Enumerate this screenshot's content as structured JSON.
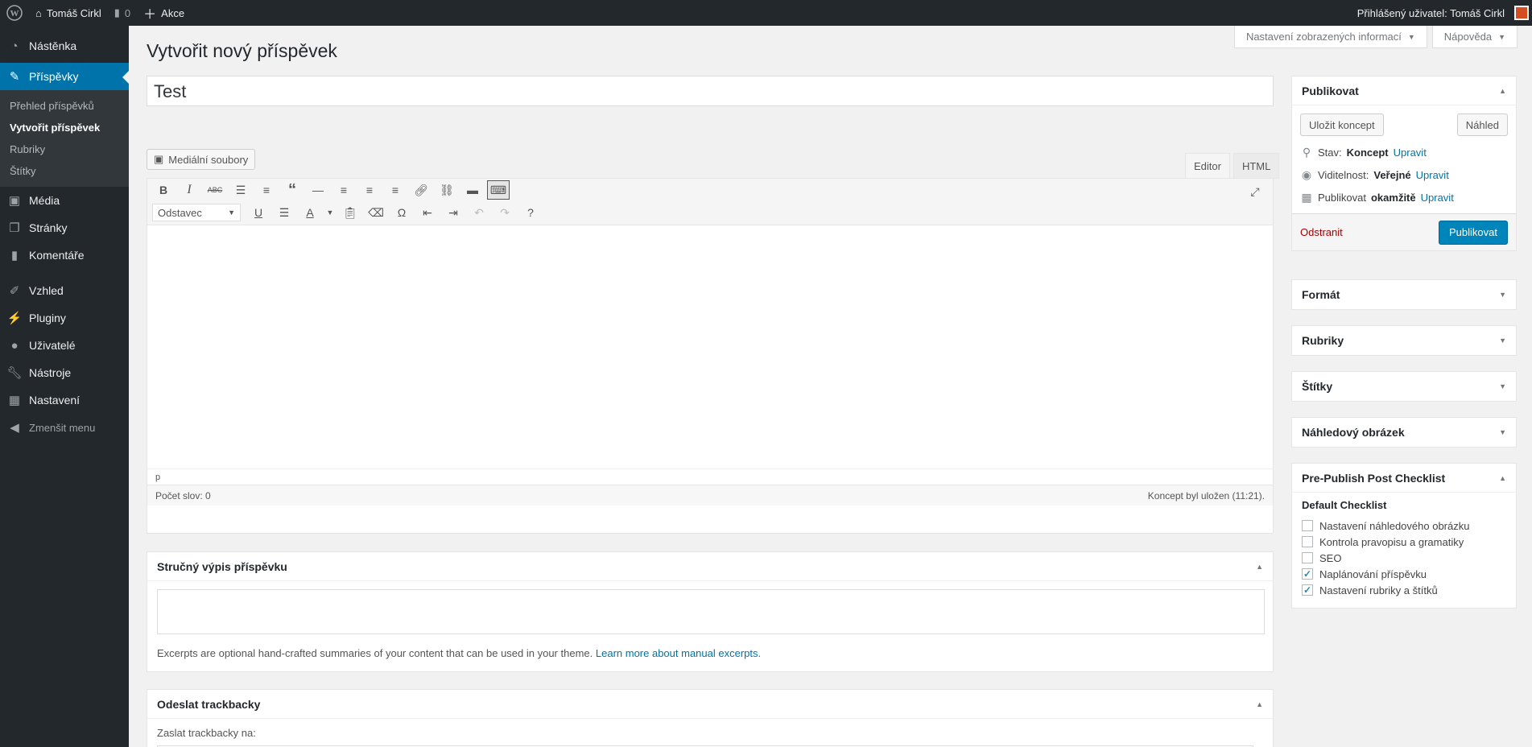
{
  "admin_bar": {
    "site_name": "Tomáš Cirkl",
    "comments_count": "0",
    "new_label": "Akce",
    "greeting": "Přihlášený uživatel: Tomáš Cirkl"
  },
  "sidebar": {
    "items": [
      {
        "label": "Nástěnka",
        "icon": "dashboard-icon"
      },
      {
        "label": "Příspěvky",
        "icon": "pin-icon"
      },
      {
        "label": "Média",
        "icon": "media-icon"
      },
      {
        "label": "Stránky",
        "icon": "pages-icon"
      },
      {
        "label": "Komentáře",
        "icon": "comments-icon"
      },
      {
        "label": "Vzhled",
        "icon": "appearance-icon"
      },
      {
        "label": "Pluginy",
        "icon": "plugins-icon"
      },
      {
        "label": "Uživatelé",
        "icon": "users-icon"
      },
      {
        "label": "Nástroje",
        "icon": "tools-icon"
      },
      {
        "label": "Nastavení",
        "icon": "settings-icon"
      }
    ],
    "submenu": [
      "Přehled příspěvků",
      "Vytvořit příspěvek",
      "Rubriky",
      "Štítky"
    ],
    "collapse_label": "Zmenšit menu"
  },
  "screen_options": {
    "label": "Nastavení zobrazených informací"
  },
  "help": {
    "label": "Nápověda"
  },
  "page_title": "Vytvořit nový příspěvek",
  "post_title": "Test",
  "media_button": "Mediální soubory",
  "editor": {
    "tabs": [
      "Editor",
      "HTML"
    ],
    "format_select": "Odstavec",
    "path": "p",
    "word_count": "Počet slov: 0",
    "draft_saved": "Koncept byl uložen (11:21)."
  },
  "excerpt": {
    "title": "Stručný výpis příspěvku",
    "help_text": "Excerpts are optional hand-crafted summaries of your content that can be used in your theme.",
    "help_link": "Learn more about manual excerpts."
  },
  "trackbacks": {
    "title": "Odeslat trackbacky",
    "label": "Zaslat trackbacky na:"
  },
  "publish": {
    "title": "Publikovat",
    "save_draft": "Uložit koncept",
    "preview": "Náhled",
    "status_label": "Stav:",
    "status_value": "Koncept",
    "visibility_label": "Viditelnost:",
    "visibility_value": "Veřejné",
    "publish_label": "Publikovat",
    "publish_value": "okamžitě",
    "edit_link": "Upravit",
    "delete": "Odstranit",
    "publish_button": "Publikovat"
  },
  "boxes": {
    "format": "Formát",
    "categories": "Rubriky",
    "tags": "Štítky",
    "featured_image": "Náhledový obrázek"
  },
  "checklist": {
    "title": "Pre-Publish Post Checklist",
    "subtitle": "Default Checklist",
    "items": [
      {
        "label": "Nastavení náhledového obrázku",
        "checked": false
      },
      {
        "label": "Kontrola pravopisu a gramatiky",
        "checked": false
      },
      {
        "label": "SEO",
        "checked": false
      },
      {
        "label": "Naplánování příspěvku",
        "checked": true
      },
      {
        "label": "Nastavení rubriky a štítků",
        "checked": true
      }
    ]
  },
  "colors": {
    "accent": "#0073aa",
    "sidebar": "#23282d",
    "primary_button": "#0085ba",
    "delete": "#a00"
  }
}
